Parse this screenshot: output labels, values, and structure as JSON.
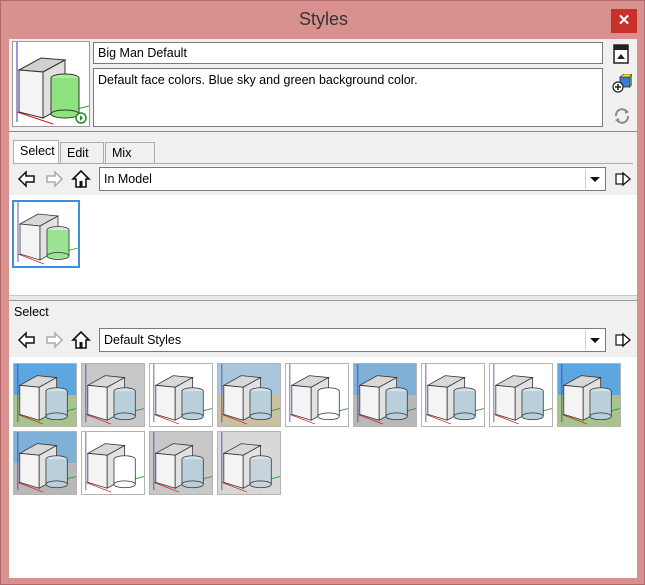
{
  "window": {
    "title": "Styles",
    "close_glyph": "✕"
  },
  "style": {
    "name": "Big Man Default",
    "description": "Default face colors. Blue sky and green background color."
  },
  "side_icons": [
    "display-secondary-pane-icon",
    "create-style-icon",
    "update-style-icon"
  ],
  "tabs": [
    {
      "label": "Select",
      "active": true
    },
    {
      "label": "Edit",
      "active": false
    },
    {
      "label": "Mix",
      "active": false
    }
  ],
  "top_browser": {
    "collection": "In Model",
    "thumbnails": [
      {
        "bg": "#ffffff",
        "face": "#9ce394",
        "selected": true
      }
    ]
  },
  "secondary": {
    "header": "Select",
    "collection": "Default Styles",
    "thumbnails": [
      {
        "bg": "sky-green",
        "face": "#b9cfdc"
      },
      {
        "bg": "grey",
        "face": "#b9cfdc"
      },
      {
        "bg": "#ffffff",
        "face": "#b9cfdc"
      },
      {
        "bg": "sky-tan",
        "face": "#b9cfdc"
      },
      {
        "bg": "#ffffff",
        "face": "#ffffff"
      },
      {
        "bg": "sky-grey",
        "face": "#b9cfdc"
      },
      {
        "bg": "#ffffff",
        "face": "#b9cfdc"
      },
      {
        "bg": "#ffffff",
        "face": "#b9cfdc"
      },
      {
        "bg": "sky-green",
        "face": "#b9cfdc"
      },
      {
        "bg": "sky-grey",
        "face": "#b9cfdc"
      },
      {
        "bg": "#ffffff",
        "face": "#ffffff"
      },
      {
        "bg": "grey",
        "face": "#b9cfdc"
      },
      {
        "bg": "#d8d8d8",
        "face": "#c8d3dc"
      }
    ]
  },
  "colors": {
    "frame": "#d99190",
    "close": "#c7302b",
    "selection": "#3c8fd8"
  }
}
